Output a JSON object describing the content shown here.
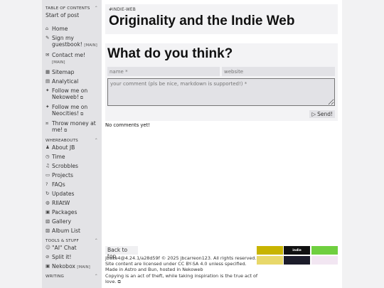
{
  "sidebar": {
    "toc": {
      "heading": "TABLE OF CONTENTS",
      "items": [
        {
          "label": "Start of post"
        }
      ]
    },
    "nav_items": [
      {
        "icon": "home-icon",
        "glyph": "⌂",
        "label": "Home",
        "tag": "",
        "ext": false
      },
      {
        "icon": "signup-icon",
        "glyph": "✎",
        "label": "Sign my guestbook!",
        "tag": "[MAIN]",
        "ext": false
      },
      {
        "icon": "contact-icon",
        "glyph": "✉",
        "label": "Contact me!",
        "tag": "[MAIN]",
        "ext": false
      },
      {
        "icon": "sitemap-icon",
        "glyph": "▦",
        "label": "Sitemap",
        "tag": "",
        "ext": false
      },
      {
        "icon": "analytics-icon",
        "glyph": "▤",
        "label": "Analytical",
        "tag": "",
        "ext": false
      },
      {
        "icon": "sparkle-icon",
        "glyph": "✦",
        "label": "Follow me on Nekoweb!",
        "tag": "",
        "ext": true
      },
      {
        "icon": "sparkle-icon",
        "glyph": "✦",
        "label": "Follow me on Neocities!",
        "tag": "",
        "ext": true
      },
      {
        "icon": "money-icon",
        "glyph": "¤",
        "label": "Throw money at me!",
        "tag": "",
        "ext": true
      }
    ],
    "whereabouts": {
      "heading": "WHEREABOUTS",
      "items": [
        {
          "icon": "person-icon",
          "glyph": "♟",
          "label": "About JB"
        },
        {
          "icon": "clock-icon",
          "glyph": "◷",
          "label": "Time"
        },
        {
          "icon": "scrobble-icon",
          "glyph": "♫",
          "label": "Scrobbles"
        },
        {
          "icon": "projects-icon",
          "glyph": "▭",
          "label": "Projects"
        },
        {
          "icon": "faq-icon",
          "glyph": "?",
          "label": "FAQs"
        },
        {
          "icon": "updates-icon",
          "glyph": "↻",
          "label": "Updates"
        },
        {
          "icon": "globe-icon",
          "glyph": "◍",
          "label": "RIIAtW"
        },
        {
          "icon": "packages-icon",
          "glyph": "▣",
          "label": "Packages"
        },
        {
          "icon": "gallery-icon",
          "glyph": "▧",
          "label": "Gallery"
        },
        {
          "icon": "album-icon",
          "glyph": "▨",
          "label": "Album List"
        }
      ]
    },
    "tools": {
      "heading": "TOOLS & STUFF",
      "items": [
        {
          "icon": "ai-chat-icon",
          "glyph": "☺",
          "label": "\"AI\" Chat",
          "tag": ""
        },
        {
          "icon": "split-icon",
          "glyph": "⊘",
          "label": "Split it!",
          "tag": ""
        },
        {
          "icon": "nekobox-icon",
          "glyph": "▣",
          "label": "Nekobox",
          "tag": "[MAIN]"
        }
      ]
    },
    "writing": {
      "heading": "WRITING"
    }
  },
  "post": {
    "tag": "#INDIE-WEB",
    "title": "Originality and the Indie Web"
  },
  "comments": {
    "title": "What do you think?",
    "name_placeholder": "name *",
    "website_placeholder": "website",
    "comment_placeholder": "your comment (pls be nice, markdown is supported!) *",
    "send_label": "Send!",
    "empty_text": "No comments yet!"
  },
  "footer": {
    "back_to_top": "Back to top",
    "version_line": "jbsite4@4.24.1/a28d59f © 2025 jbcarreon123. All rights reserved.",
    "license_line": "Site content are licensed under CC BY-SA 4.0 unless specified.",
    "made_line": "Made in Astro and Bun, hosted in Nekoweb",
    "quote_line": "Copying is an act of theft, while taking inspiration is the true act of love."
  },
  "badges": [
    {
      "name": "badge-1",
      "text": "",
      "bg": "#c8b400",
      "fg": "#111"
    },
    {
      "name": "badge-indie",
      "text": "indie",
      "bg": "#111111",
      "fg": "#ffffff"
    },
    {
      "name": "badge-3",
      "text": "",
      "bg": "#6fcf3f",
      "fg": "#1a3d0a"
    },
    {
      "name": "badge-4",
      "text": "",
      "bg": "#e8d86a",
      "fg": "#4a3d00"
    },
    {
      "name": "badge-5",
      "text": "",
      "bg": "#1c1c2a",
      "fg": "#eeeeee"
    },
    {
      "name": "badge-6",
      "text": "",
      "bg": "#f2e6f2",
      "fg": "#222"
    }
  ]
}
